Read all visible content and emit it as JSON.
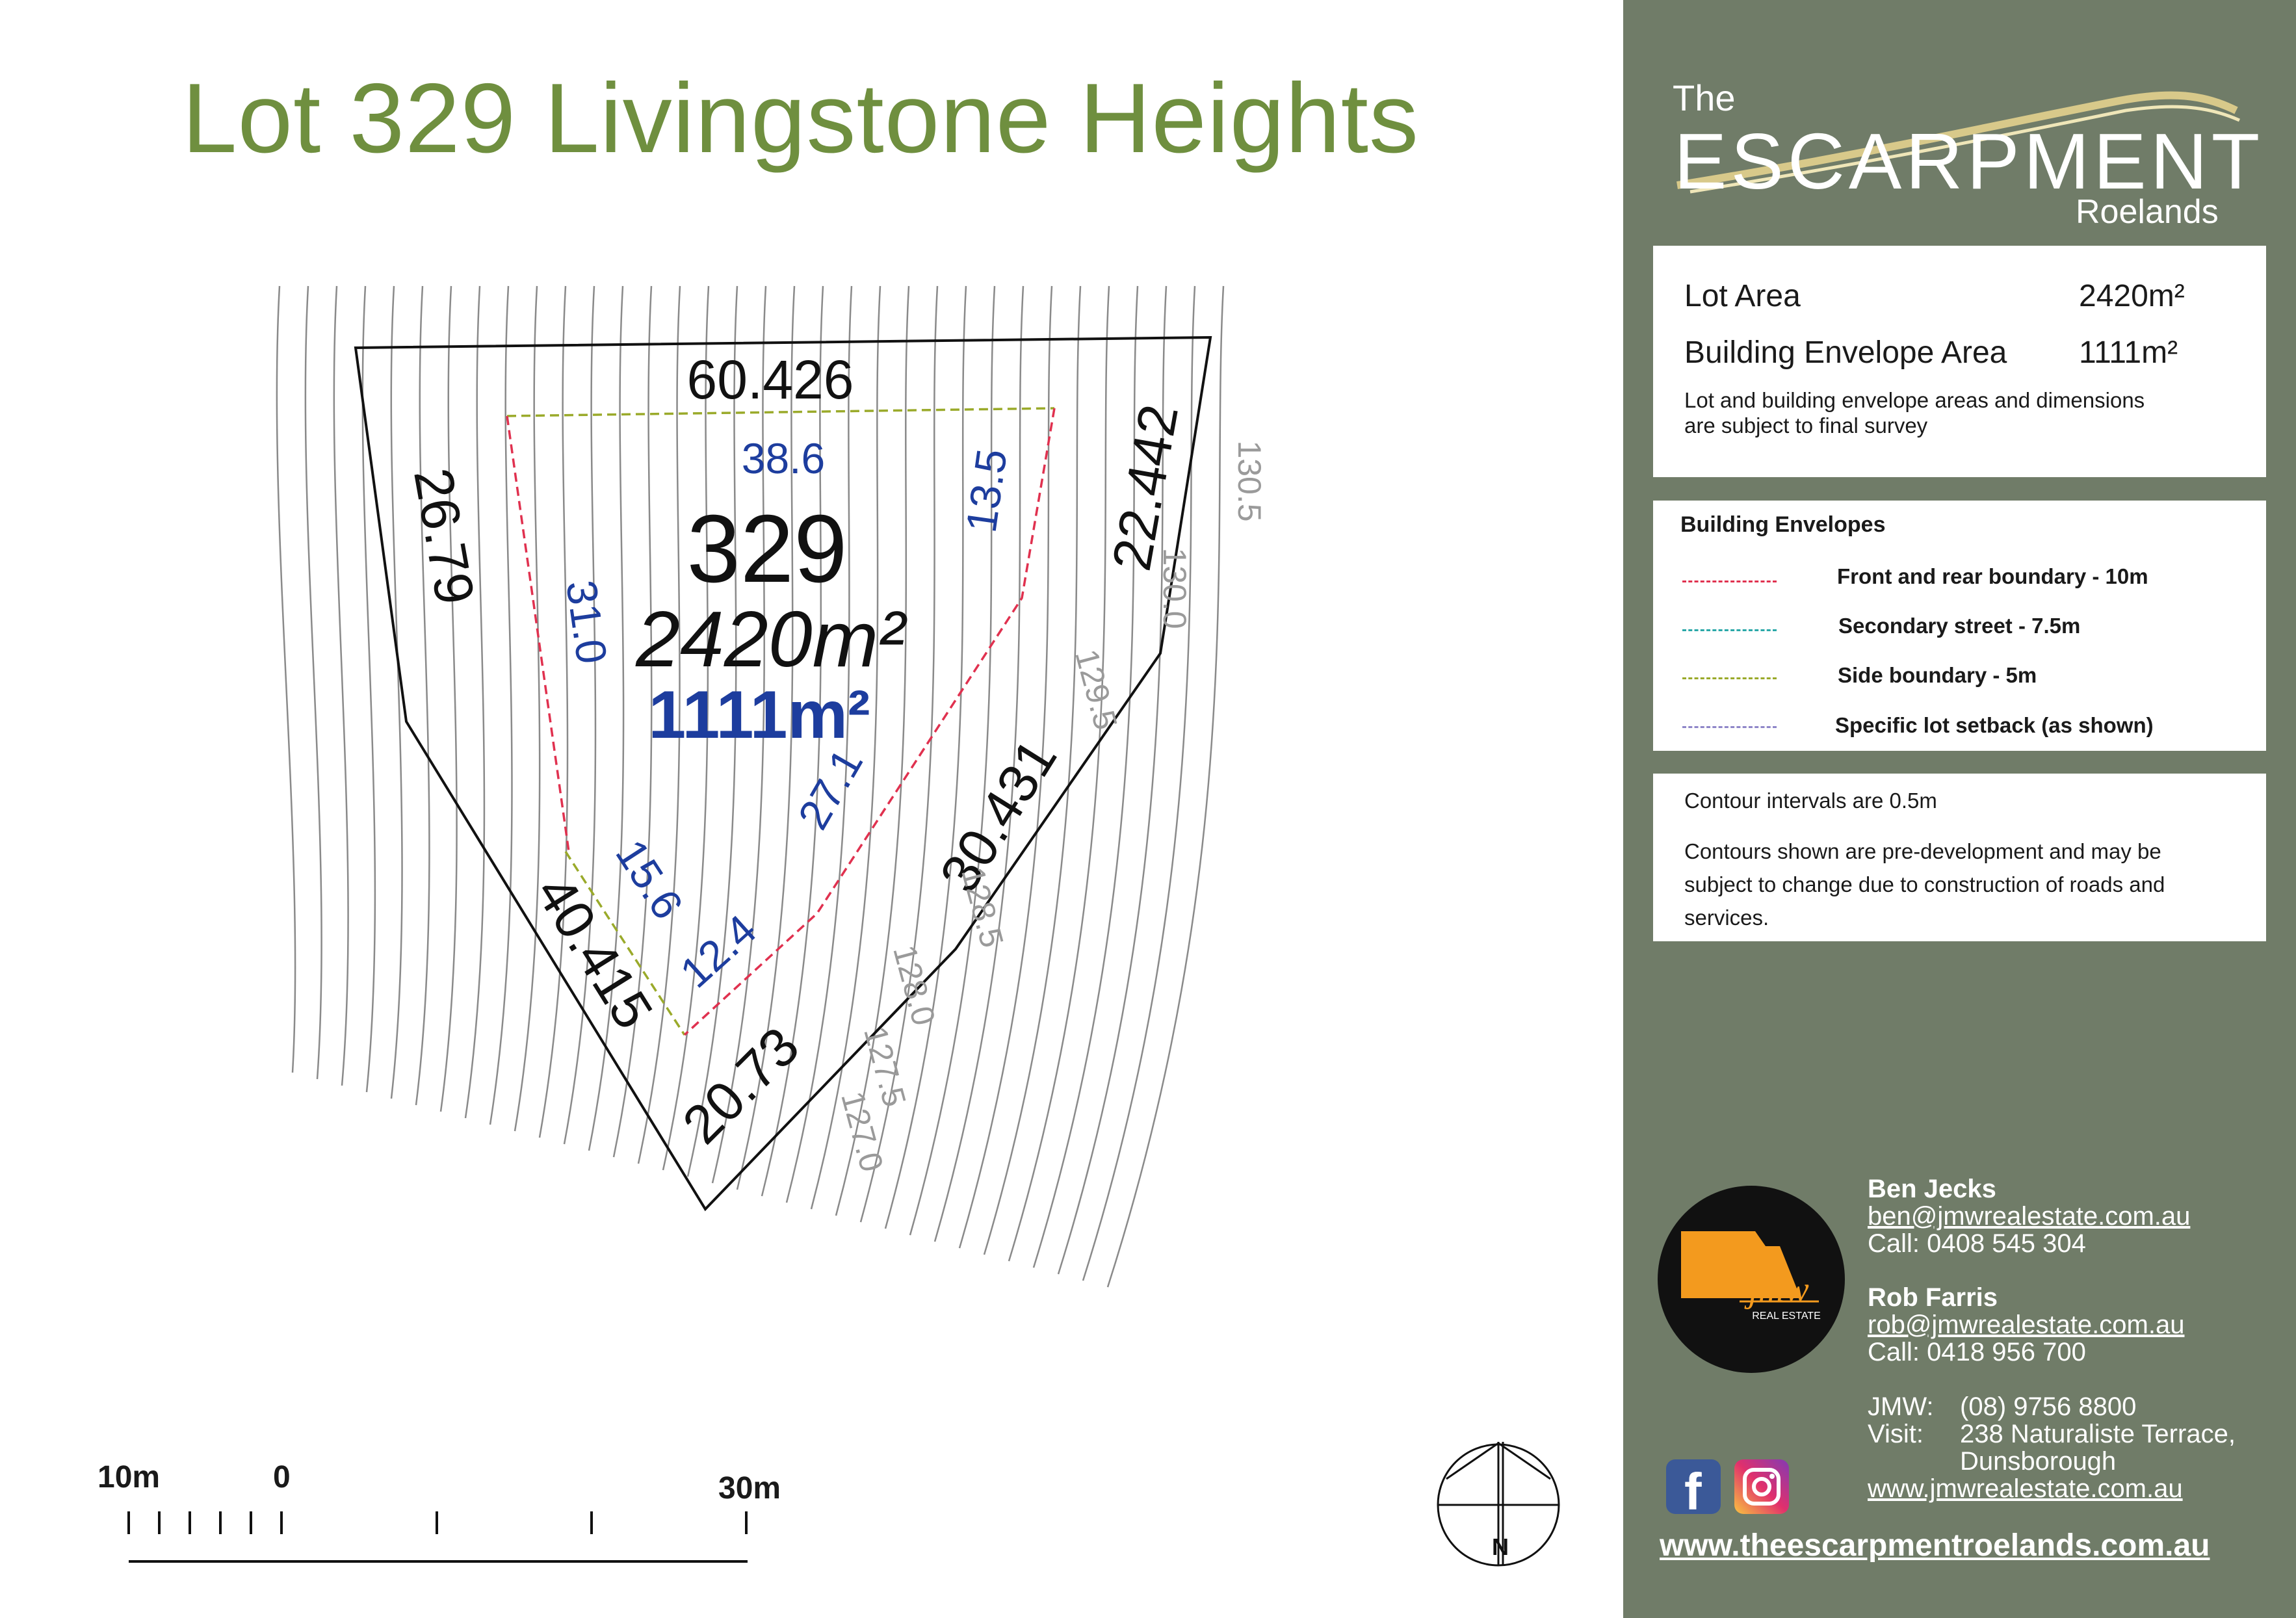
{
  "title": "Lot 329 Livingstone Heights",
  "plan": {
    "lot_number": "329",
    "lot_area": "2420m²",
    "envelope_area": "1111m²",
    "boundaries": [
      "60.426",
      "26.79",
      "22.442",
      "30.431",
      "20.73",
      "40.415"
    ],
    "setbacks": [
      "38.6",
      "31.0",
      "13.5",
      "27.1",
      "15.6",
      "12.4"
    ],
    "contours": [
      "130.5",
      "130.0",
      "129.5",
      "128.5",
      "128.0",
      "127.5",
      "127.0"
    ],
    "north_label": "N"
  },
  "scale": {
    "labels": [
      "10m",
      "0",
      "30m"
    ]
  },
  "brand": {
    "the": "The",
    "name": "ESCARPMENT",
    "place": "Roelands"
  },
  "info": {
    "lot_area_label": "Lot Area",
    "lot_area_value": "2420m²",
    "envelope_label": "Building Envelope Area",
    "envelope_value": "1111m²",
    "note_line1": "Lot and building envelope areas and dimensions",
    "note_line2": "are subject to final survey"
  },
  "legend": {
    "title": "Building Envelopes",
    "items": [
      {
        "label": "Front and rear boundary - 10m",
        "color": "#e0314f"
      },
      {
        "label": "Secondary street - 7.5m",
        "color": "#2aa8a8"
      },
      {
        "label": "Side boundary - 5m",
        "color": "#9aaa2a"
      },
      {
        "label": "Specific lot setback (as shown)",
        "color": "#8f86c8"
      }
    ]
  },
  "contour_note": {
    "line1": "Contour intervals are 0.5m",
    "line2": "Contours shown are pre-development and may be",
    "line3": "subject to change due to construction of roads and",
    "line4": "services."
  },
  "agency_logo": {
    "name": "jmw",
    "sub": "REAL ESTATE",
    "accent": "#f39a1e"
  },
  "contacts": [
    {
      "name": "Ben Jecks",
      "email": "ben@jmwrealestate.com.au",
      "call": "Call:  0408 545 304"
    },
    {
      "name": "Rob Farris",
      "email": "rob@jmwrealestate.com.au",
      "call": "Call:  0418 956 700"
    }
  ],
  "office": {
    "jmw_label": "JMW:",
    "jmw_phone": "(08) 9756 8800",
    "visit_label": "Visit:",
    "address1": "238 Naturaliste Terrace,",
    "address2": "Dunsborough",
    "website": "www.jmwrealestate.com.au"
  },
  "social": [
    {
      "name": "facebook-icon",
      "glyph": "f",
      "color": "#3b5998"
    },
    {
      "name": "instagram-icon",
      "color": "#e1306c"
    }
  ],
  "footer_website": "www.theescarpmentroelands.com.au"
}
